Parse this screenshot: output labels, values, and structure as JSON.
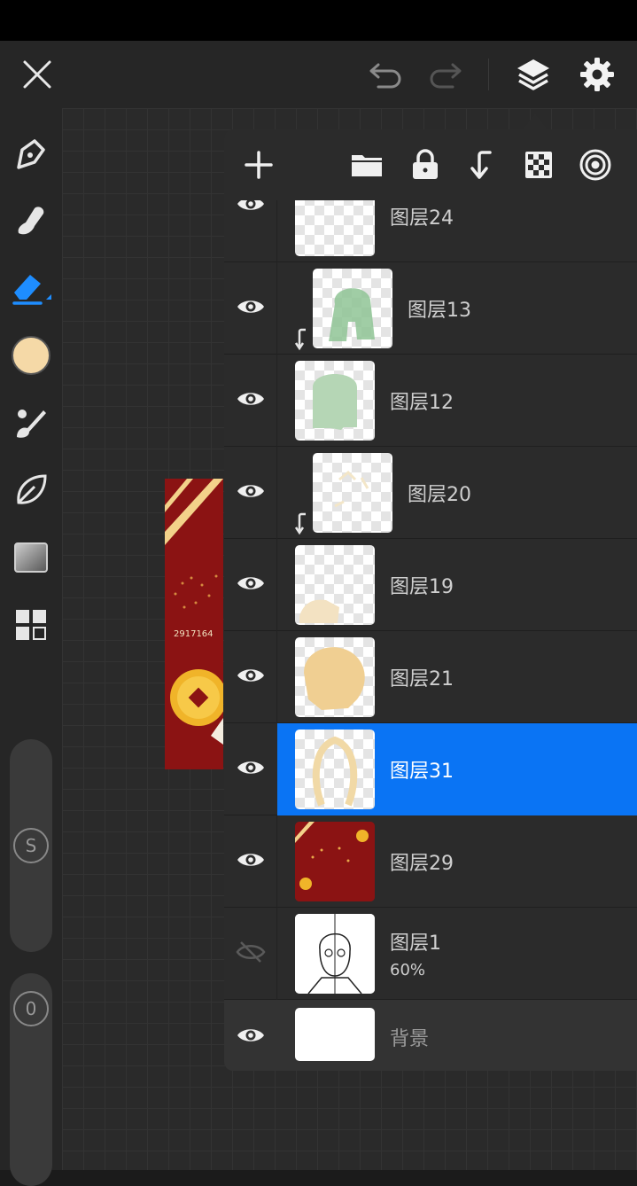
{
  "toolbar": {
    "close": "close-icon",
    "undo": "undo-icon",
    "redo": "redo-icon",
    "layers": "layers-icon",
    "settings": "gear-icon"
  },
  "colors": {
    "accent": "#0a74f4",
    "current_color": "#f5d9a7",
    "panel": "#2b2b2b",
    "topbar": "#262626"
  },
  "sidebar": {
    "tools": [
      "pen-nib-icon",
      "smudge-icon",
      "eraser-icon",
      "color-swatch",
      "brush-icon",
      "leaf-icon",
      "gradient-icon",
      "grid-icon"
    ],
    "slider_top_label": "S",
    "slider_bottom_label": "0"
  },
  "artwork": {
    "text": "2917164"
  },
  "layers_panel": {
    "header_icons": [
      "plus-icon",
      "folder-icon",
      "lock-icon",
      "merge-down-icon",
      "checker-icon",
      "radial-icon"
    ],
    "layers": [
      {
        "name": "图层24",
        "visible": true,
        "clipped": false
      },
      {
        "name": "图层13",
        "visible": true,
        "clipped": true
      },
      {
        "name": "图层12",
        "visible": true,
        "clipped": false
      },
      {
        "name": "图层20",
        "visible": true,
        "clipped": true
      },
      {
        "name": "图层19",
        "visible": true,
        "clipped": false
      },
      {
        "name": "图层21",
        "visible": true,
        "clipped": false
      },
      {
        "name": "图层31",
        "visible": true,
        "clipped": false,
        "selected": true
      },
      {
        "name": "图层29",
        "visible": true,
        "clipped": false
      },
      {
        "name": "图层1",
        "visible": false,
        "clipped": false,
        "opacity": "60%"
      },
      {
        "name": "背景",
        "visible": true,
        "clipped": false,
        "background": true
      }
    ]
  }
}
